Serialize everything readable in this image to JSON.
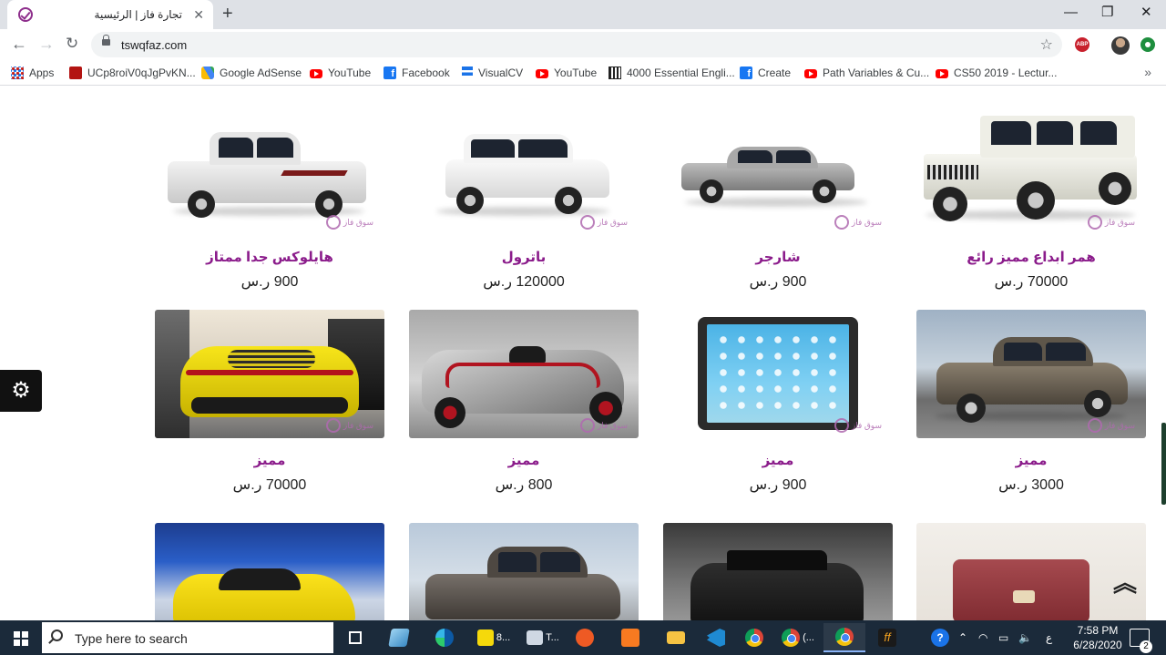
{
  "browser": {
    "tab_title": "تجارة فاز | الرئيسية",
    "tab_close": "✕",
    "new_tab": "+",
    "url": "tswqfaz.com",
    "window_controls": {
      "minimize": "—",
      "maximize": "❐",
      "close": "✕"
    },
    "ext_abp": "ABP"
  },
  "bookmarks": [
    {
      "label": "Apps",
      "icon": "apps-grid-icon"
    },
    {
      "label": "UCp8roiV0qJgPvKN...",
      "icon": "red-square-icon"
    },
    {
      "label": "Google AdSense",
      "icon": "adsense-icon"
    },
    {
      "label": "YouTube",
      "icon": "youtube-icon"
    },
    {
      "label": "Facebook",
      "icon": "facebook-icon"
    },
    {
      "label": "VisualCV",
      "icon": "visualcv-icon"
    },
    {
      "label": "YouTube",
      "icon": "youtube-icon"
    },
    {
      "label": "4000 Essential Engli...",
      "icon": "book-icon"
    },
    {
      "label": "Create",
      "icon": "facebook-icon"
    },
    {
      "label": "Path Variables & Cu...",
      "icon": "youtube-icon"
    },
    {
      "label": "CS50 2019 - Lectur...",
      "icon": "youtube-icon"
    }
  ],
  "products": [
    {
      "name": "هايلوكس جدا ممتاز",
      "price": "900 ر.س"
    },
    {
      "name": "باترول",
      "price": "120000 ر.س"
    },
    {
      "name": "شارجر",
      "price": "900 ر.س"
    },
    {
      "name": "همر ابداع مميز رائع",
      "price": "70000 ر.س"
    },
    {
      "name": "مميز",
      "price": "70000 ر.س"
    },
    {
      "name": "مميز",
      "price": "800 ر.س"
    },
    {
      "name": "مميز",
      "price": "900 ر.س"
    },
    {
      "name": "مميز",
      "price": "3000 ر.س"
    }
  ],
  "watermark": "سوق فاز",
  "taskbar": {
    "search_placeholder": "Type here to search",
    "app_label_8": "8...",
    "app_label_t": "T...",
    "app_label_chrome": "(...",
    "lang": "ع",
    "time": "7:58 PM",
    "date": "6/28/2020",
    "notifications": "2"
  },
  "colors": {
    "accent_purple": "#8b1c8b",
    "taskbar": "#1b2a3a"
  }
}
